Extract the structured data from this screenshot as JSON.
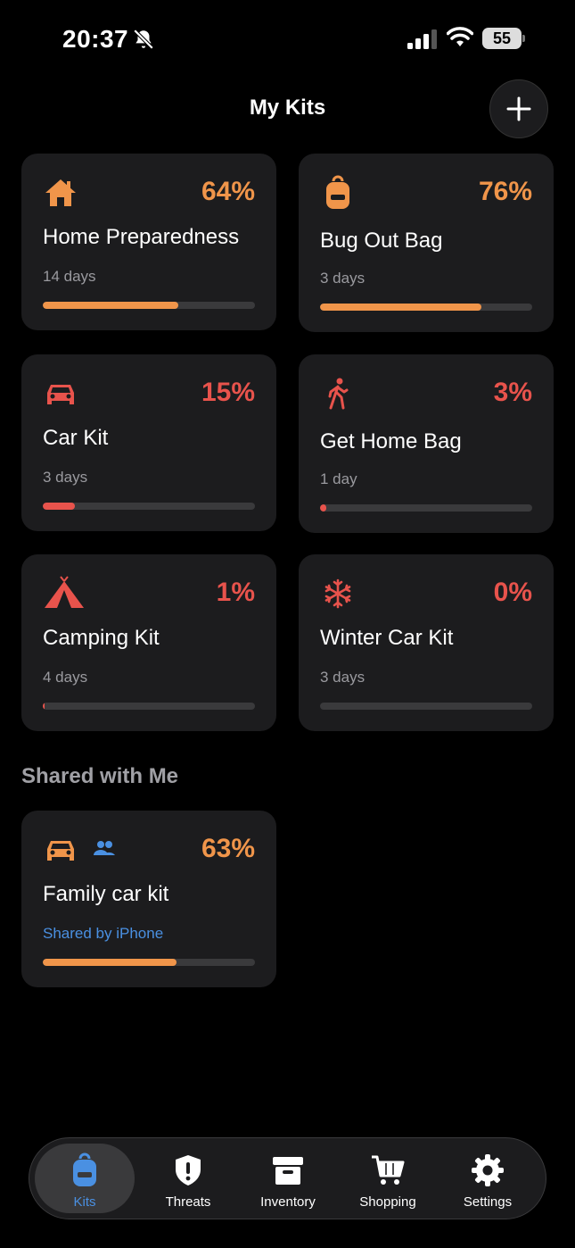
{
  "status_bar": {
    "time": "20:37",
    "battery": "55"
  },
  "header": {
    "title": "My Kits"
  },
  "colors": {
    "orange": "#f0954a",
    "red": "#e8534c",
    "blue": "#4a90e2",
    "card_bg": "#1c1c1e"
  },
  "kits": [
    {
      "name": "Home Preparedness",
      "percent": "64%",
      "progress": 0.64,
      "duration": "14 days",
      "icon": "house-icon",
      "color": "orange"
    },
    {
      "name": "Bug Out Bag",
      "percent": "76%",
      "progress": 0.76,
      "duration": "3 days",
      "icon": "backpack-icon",
      "color": "orange"
    },
    {
      "name": "Car Kit",
      "percent": "15%",
      "progress": 0.15,
      "duration": "3 days",
      "icon": "car-icon",
      "color": "red"
    },
    {
      "name": "Get Home Bag",
      "percent": "3%",
      "progress": 0.03,
      "duration": "1 day",
      "icon": "walking-person-icon",
      "color": "red"
    },
    {
      "name": "Camping Kit",
      "percent": "1%",
      "progress": 0.01,
      "duration": "4 days",
      "icon": "tent-icon",
      "color": "red"
    },
    {
      "name": "Winter Car Kit",
      "percent": "0%",
      "progress": 0.0,
      "duration": "3 days",
      "icon": "snowflake-icon",
      "color": "red"
    }
  ],
  "shared": {
    "title": "Shared with Me",
    "kits": [
      {
        "name": "Family car kit",
        "percent": "63%",
        "progress": 0.63,
        "shared_by": "Shared by iPhone",
        "icon": "car-icon",
        "color": "orange"
      }
    ]
  },
  "tabs": [
    {
      "label": "Kits",
      "icon": "backpack-icon",
      "active": true
    },
    {
      "label": "Threats",
      "icon": "shield-exclamation-icon",
      "active": false
    },
    {
      "label": "Inventory",
      "icon": "archive-box-icon",
      "active": false
    },
    {
      "label": "Shopping",
      "icon": "cart-icon",
      "active": false
    },
    {
      "label": "Settings",
      "icon": "gear-icon",
      "active": false
    }
  ]
}
